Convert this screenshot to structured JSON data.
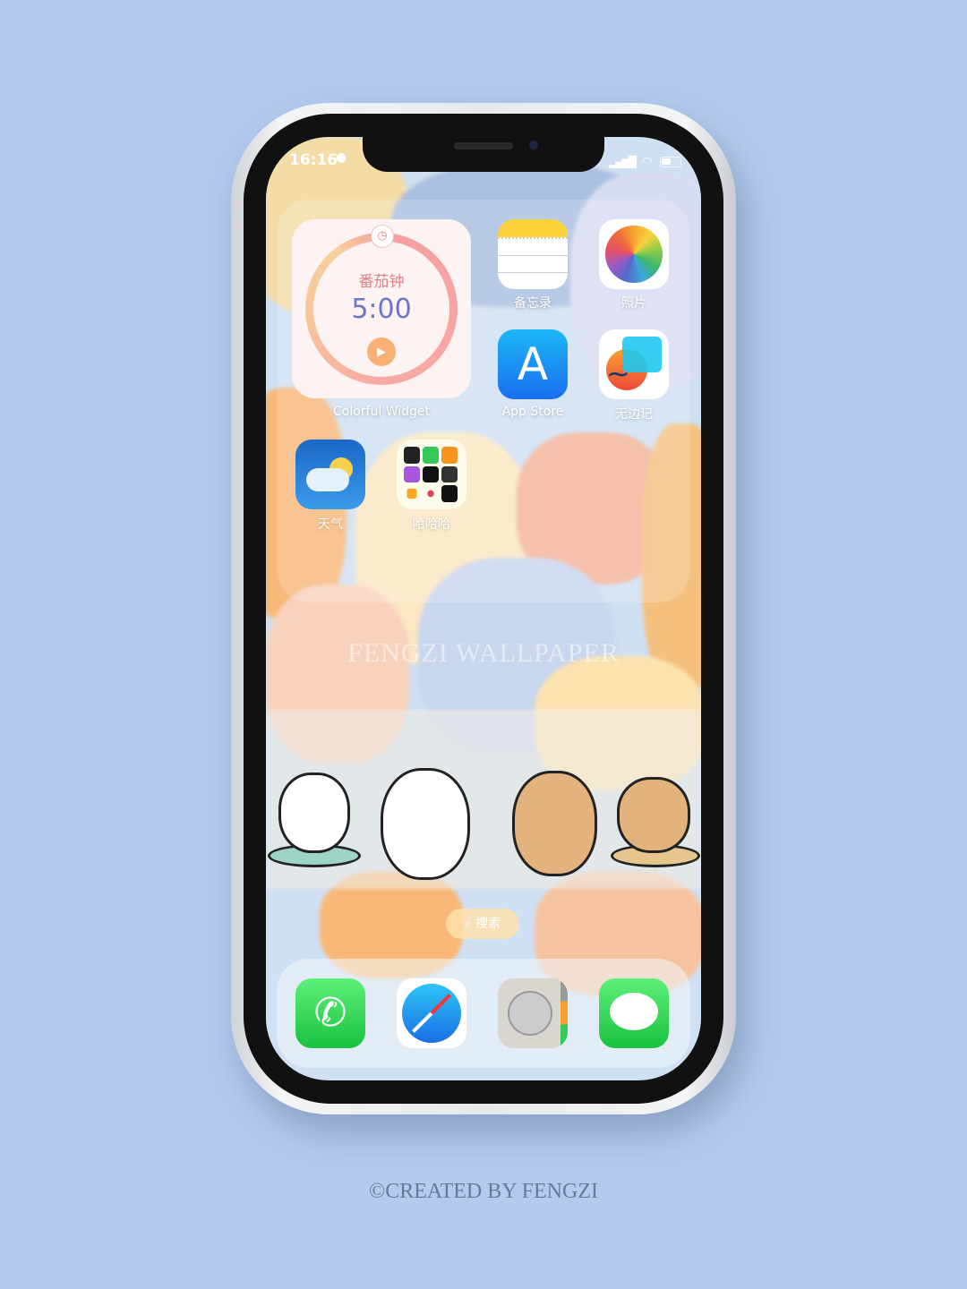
{
  "status": {
    "time": "16:16"
  },
  "widget": {
    "title": "番茄钟",
    "time": "5:00",
    "label": "Colorful Widget"
  },
  "apps": [
    {
      "id": "notes",
      "label": "备忘录",
      "icon": "notes-icon"
    },
    {
      "id": "photos",
      "label": "照片",
      "icon": "photos-icon"
    },
    {
      "id": "appstore",
      "label": "App Store",
      "icon": "app-store-icon"
    },
    {
      "id": "freeform",
      "label": "无边记",
      "icon": "freeform-icon"
    },
    {
      "id": "weather",
      "label": "天气",
      "icon": "weather-icon"
    },
    {
      "id": "folder",
      "label": "哈哈哈",
      "icon": "folder-icon"
    }
  ],
  "watermark": "FENGZI WALLPAPER",
  "search": {
    "label": "搜索"
  },
  "dock": [
    {
      "icon": "phone-icon"
    },
    {
      "icon": "safari-icon"
    },
    {
      "icon": "contacts-icon"
    },
    {
      "icon": "messages-icon"
    }
  ],
  "footer": "©CREATED BY FENGZI"
}
